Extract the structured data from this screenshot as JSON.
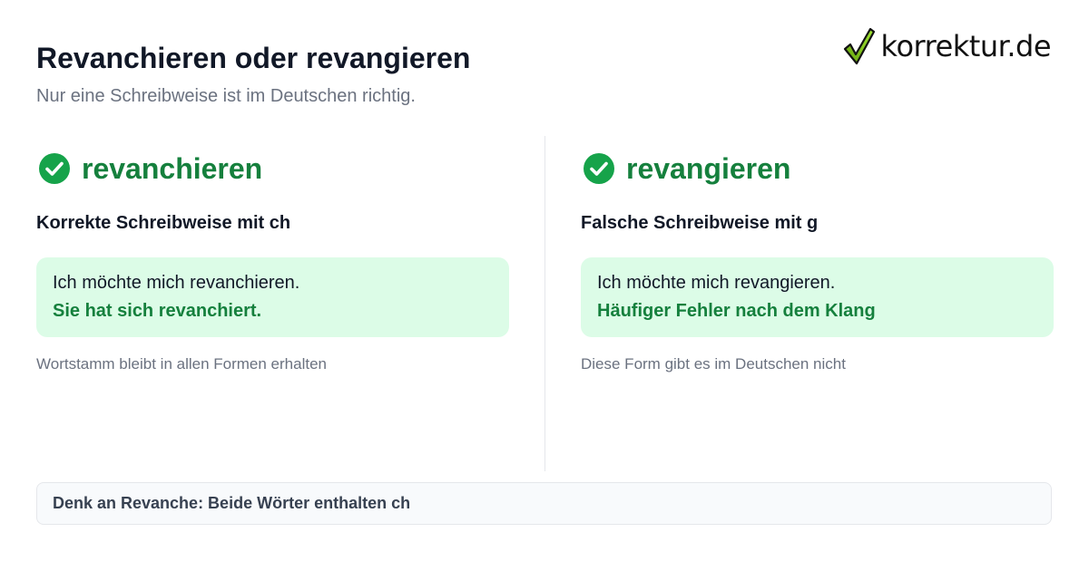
{
  "header": {
    "title": "Revanchieren oder revangieren",
    "subtitle": "Nur eine Schreibweise ist im Deutschen richtig."
  },
  "logo": {
    "text": "korrektur.de",
    "icon": "checkmark-icon"
  },
  "columns": [
    {
      "icon": "check-circle-icon",
      "word": "revanchieren",
      "label": "Korrekte Schreibweise mit ch",
      "example_1": "Ich möchte mich revanchieren.",
      "example_2": "Sie hat sich revanchiert.",
      "note": "Wortstamm bleibt in allen Formen erhalten"
    },
    {
      "icon": "check-circle-icon",
      "word": "revangieren",
      "label": "Falsche Schreibweise mit g",
      "example_1": "Ich möchte mich revangieren.",
      "example_2": "Häufiger Fehler nach dem Klang",
      "note": "Diese Form gibt es im Deutschen nicht"
    }
  ],
  "footer": {
    "text": "Denk an Revanche: Beide Wörter enthalten ch"
  },
  "colors": {
    "accent_green": "#15803d",
    "icon_green": "#16a34a",
    "box_background": "#dcfce7",
    "title": "#111827",
    "muted": "#6b7280"
  }
}
